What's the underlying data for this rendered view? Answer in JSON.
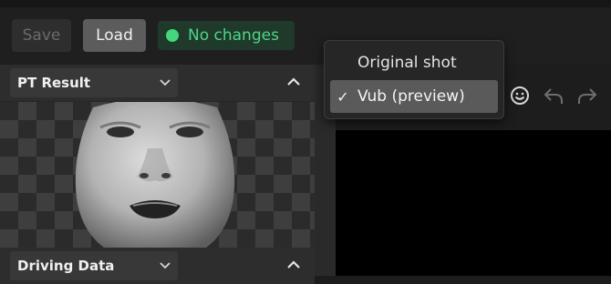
{
  "toolbar": {
    "save_label": "Save",
    "load_label": "Load",
    "status_text": "No changes",
    "status_color": "#46d47e"
  },
  "panels": [
    {
      "title": "PT Result"
    },
    {
      "title": "Driving Data"
    }
  ],
  "dropdown": {
    "items": [
      {
        "label": "Original shot",
        "selected": false
      },
      {
        "label": "Vub (preview)",
        "selected": true,
        "check": "✓"
      }
    ]
  },
  "icons": [
    "face-icon",
    "undo-icon",
    "redo-icon"
  ]
}
